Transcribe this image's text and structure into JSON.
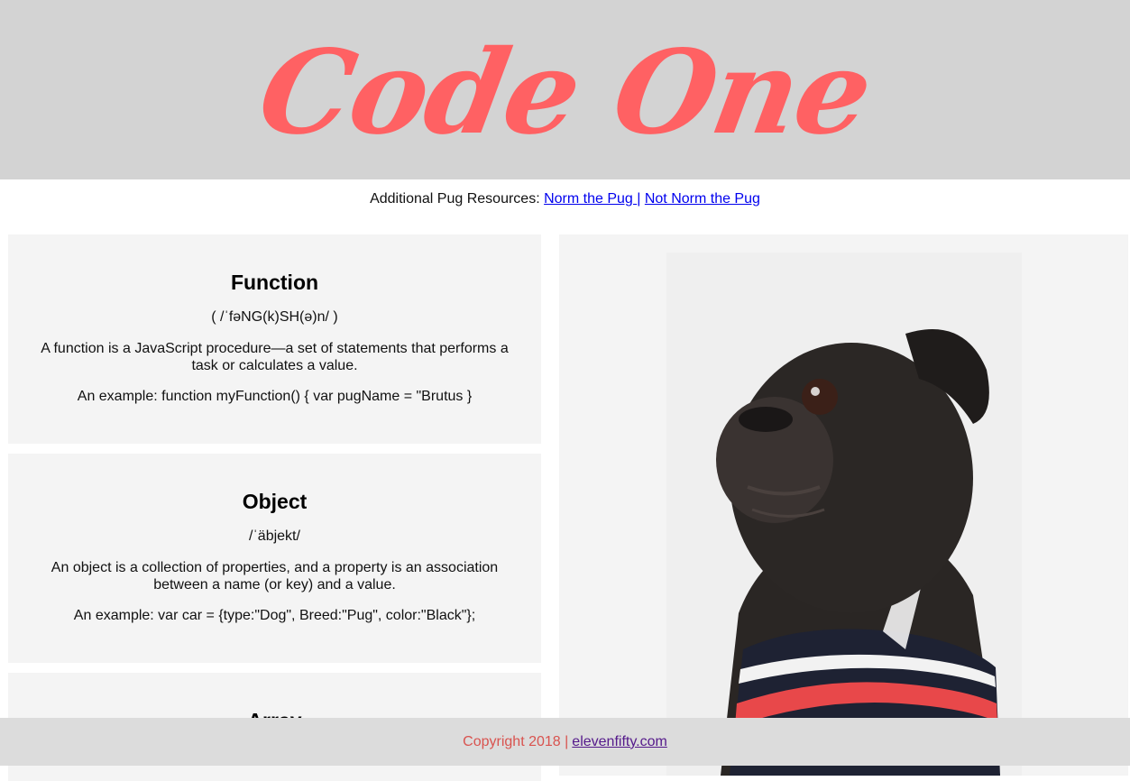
{
  "header": {
    "logo_text": "Code One"
  },
  "resources": {
    "prefix": "Additional Pug Resources: ",
    "link1": "Norm the Pug ",
    "separator": "|",
    "link2": "Not Norm the Pug"
  },
  "cards": [
    {
      "title": "Function",
      "pronunciation": "( /ˈfəNG(k)SH(ə)n/ )",
      "description": "A function is a JavaScript procedure—a set of statements that performs a task or calculates a value.",
      "example": "An example: function myFunction() { var pugName = \"Brutus }"
    },
    {
      "title": "Object",
      "pronunciation": "/ˈäbjekt/",
      "description": "An object is a collection of properties, and a property is an association between a name (or key) and a value.",
      "example": "An example: var car = {type:\"Dog\", Breed:\"Pug\", color:\"Black\"};"
    },
    {
      "title": "Array"
    }
  ],
  "photo": {
    "subject": "black pug wearing striped sweater"
  },
  "footer": {
    "copyright": "Copyright 2018 | ",
    "link": "elevenfifty.com"
  },
  "colors": {
    "header_bg": "#d3d3d3",
    "logo": "#ff6163",
    "card_bg": "#f4f4f4",
    "footer_bg": "#dcdcdc",
    "footer_text": "#d9534f"
  }
}
